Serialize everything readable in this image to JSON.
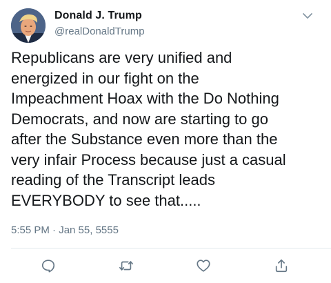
{
  "author": {
    "display_name": "Donald J. Trump",
    "handle": "@realDonaldTrump",
    "avatar_icon": "profile-photo"
  },
  "tweet": {
    "lines": [
      "Republicans are very unified and",
      "energized in our fight on the",
      "Impeachment Hoax with the Do Nothing",
      "Democrats, and now are starting to go",
      "after the Substance even more than the",
      "very infair Process because just a casual",
      "reading of the Transcript leads",
      "EVERYBODY to see that....."
    ],
    "timestamp": "5:55 PM · Jan 55, 5555"
  },
  "actions": {
    "reply_icon": "comment-icon",
    "retweet_icon": "retweet-icon",
    "like_icon": "heart-icon",
    "share_icon": "share-icon"
  },
  "colors": {
    "text_primary": "#14171a",
    "text_secondary": "#657786",
    "icon": "#657786",
    "divider": "#e1e8ed"
  }
}
